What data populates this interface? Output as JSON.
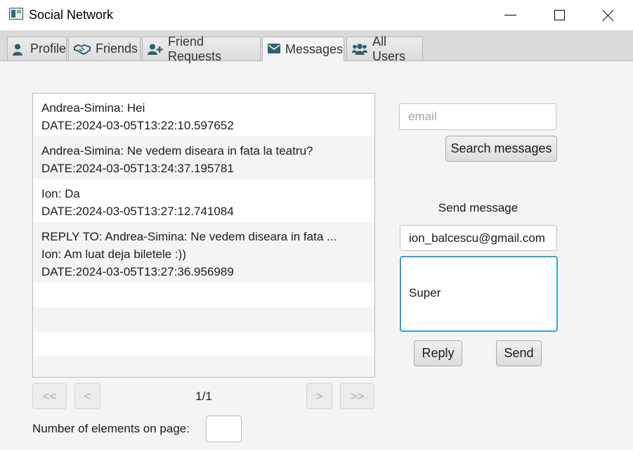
{
  "window": {
    "title": "Social Network"
  },
  "tabs": [
    {
      "label": "Profile",
      "icon": "user-icon"
    },
    {
      "label": "Friends",
      "icon": "handshake-icon"
    },
    {
      "label": "Friend Requests",
      "icon": "user-plus-icon"
    },
    {
      "label": "Messages",
      "icon": "envelope-icon",
      "active": true
    },
    {
      "label": "All Users",
      "icon": "users-icon"
    }
  ],
  "messages": [
    {
      "lines": [
        "Andrea-Simina: Hei",
        "DATE:2024-03-05T13:22:10.597652"
      ]
    },
    {
      "lines": [
        "Andrea-Simina: Ne vedem diseara in fata la teatru?",
        "DATE:2024-03-05T13:24:37.195781"
      ]
    },
    {
      "lines": [
        "Ion: Da",
        "DATE:2024-03-05T13:27:12.741084"
      ]
    },
    {
      "lines": [
        "REPLY TO: Andrea-Simina: Ne vedem diseara in fata ...",
        "Ion: Am luat deja biletele :))",
        "DATE:2024-03-05T13:27:36.956989"
      ]
    }
  ],
  "pagination": {
    "first_label": "<<",
    "prev_label": "<",
    "next_label": ">",
    "last_label": ">>",
    "page_indicator": "1/1",
    "elements_label": "Number of elements on page:",
    "elements_value": ""
  },
  "search": {
    "placeholder": "email",
    "value": "",
    "button_label": "Search messages"
  },
  "compose": {
    "heading": "Send message",
    "recipient": "ion_balcescu@gmail.com",
    "text": "Super",
    "reply_label": "Reply",
    "send_label": "Send"
  },
  "colors": {
    "focus_border": "#2fa4d6",
    "icon": "#2f6070"
  }
}
